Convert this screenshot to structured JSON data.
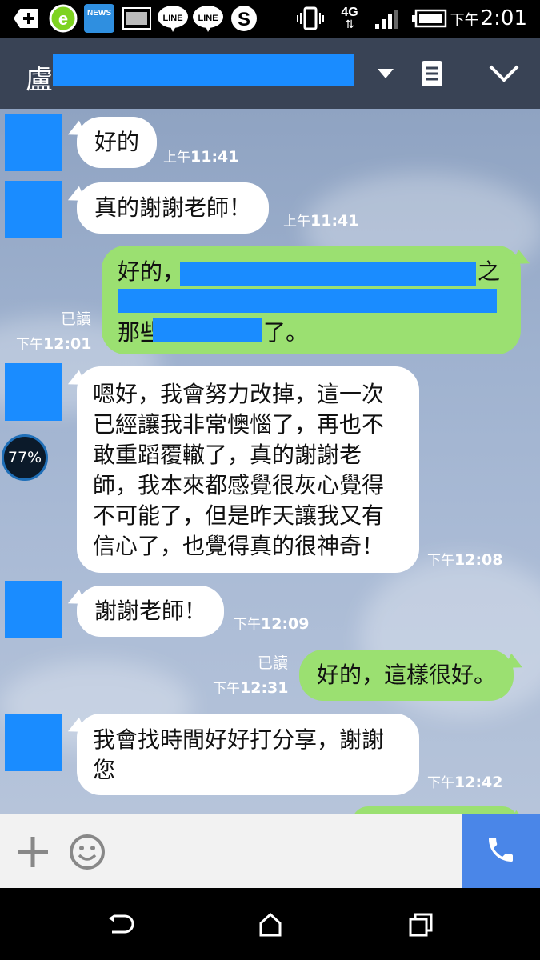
{
  "status_bar": {
    "icons": [
      "add-icon",
      "browser-icon",
      "news-icon",
      "gallery-icon",
      "line-icon",
      "line-icon",
      "skype-icon",
      "vibrate-icon",
      "4g-icon",
      "signal-icon",
      "battery-icon"
    ],
    "news_label": "NEWS",
    "line_label": "LINE",
    "network": "4G",
    "clock_ampm": "下午",
    "clock_time": "2:01"
  },
  "header": {
    "contact_initial": "盧"
  },
  "messages": [
    {
      "side": "in",
      "text_lines": [
        "好的"
      ],
      "ampm": "上午",
      "time": "11:41"
    },
    {
      "side": "in",
      "text_lines": [
        "真的謝謝老師！"
      ],
      "ampm": "上午",
      "time": "11:41"
    },
    {
      "side": "out",
      "text_lines": [
        "好的，",
        "之",
        "那些",
        "了。"
      ],
      "read": "已讀",
      "ampm": "下午",
      "time": "12:01"
    },
    {
      "side": "in",
      "text_lines": [
        "嗯好，我會努力改掉，這一次",
        "已經讓我非常懊惱了，再也不",
        "敢重蹈覆轍了，真的謝謝老",
        "師，我本來都感覺很灰心覺得",
        "不可能了，但是昨天讓我又有",
        "信心了，也覺得真的很神奇！"
      ],
      "ampm": "下午",
      "time": "12:08"
    },
    {
      "side": "in",
      "text_lines": [
        "謝謝老師！"
      ],
      "ampm": "下午",
      "time": "12:09"
    },
    {
      "side": "out",
      "text_lines": [
        "好的，這樣很好。"
      ],
      "read": "已讀",
      "ampm": "下午",
      "time": "12:31"
    },
    {
      "side": "in",
      "text_lines": [
        "我會找時間好好打分享，謝謝",
        "您"
      ],
      "ampm": "下午",
      "time": "12:42"
    }
  ],
  "overlay": {
    "battery_gauge": "77%"
  },
  "input_bar": {
    "icons": [
      "plus-icon",
      "emoji-icon",
      "phone-icon"
    ]
  },
  "nav_bar": {
    "icons": [
      "back-icon",
      "home-icon",
      "recents-icon"
    ]
  },
  "colors": {
    "header_bg": "#394355",
    "out_bubble": "#9be071",
    "in_bubble": "#ffffff",
    "redaction": "#1a8cff",
    "call_button": "#4a86e8"
  }
}
